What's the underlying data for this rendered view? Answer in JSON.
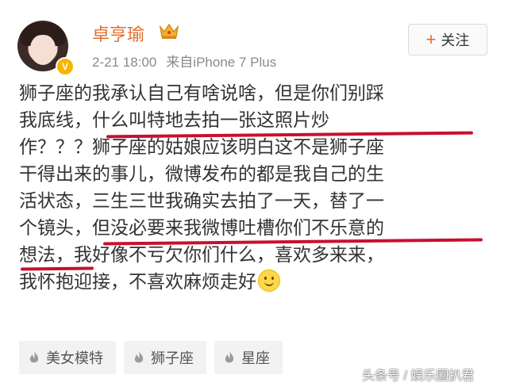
{
  "user": {
    "name": "卓亨瑜",
    "verified_badge": "V",
    "crown_icon": "crown-icon",
    "time": "2-21 18:00",
    "source": "来自iPhone 7 Plus"
  },
  "follow_button": {
    "plus": "+",
    "label": "关注"
  },
  "post": {
    "lines": [
      "狮子座的我承认自己有啥说啥，但是你们别踩",
      "我底线，什么叫特地去拍一张这照片炒",
      "作？？？狮子座的姑娘应该明白这不是狮子座",
      "干得出来的事儿，微博发布的都是我自己的生",
      "活状态，三生三世我确实去拍了一天，替了一",
      "个镜头，但没必要来我微博吐槽你们不乐意的",
      "想法，我好像不亏欠你们什么，喜欢多来来，",
      "我怀抱迎接，不喜欢麻烦走好"
    ],
    "highlight_color": "#c8102e"
  },
  "tags": [
    "美女模特",
    "狮子座",
    "星座"
  ],
  "watermark": "头条号 / 娱乐圈扒君",
  "colors": {
    "username": "#e46c2a",
    "meta": "#8a8a8a",
    "text": "#333333"
  }
}
